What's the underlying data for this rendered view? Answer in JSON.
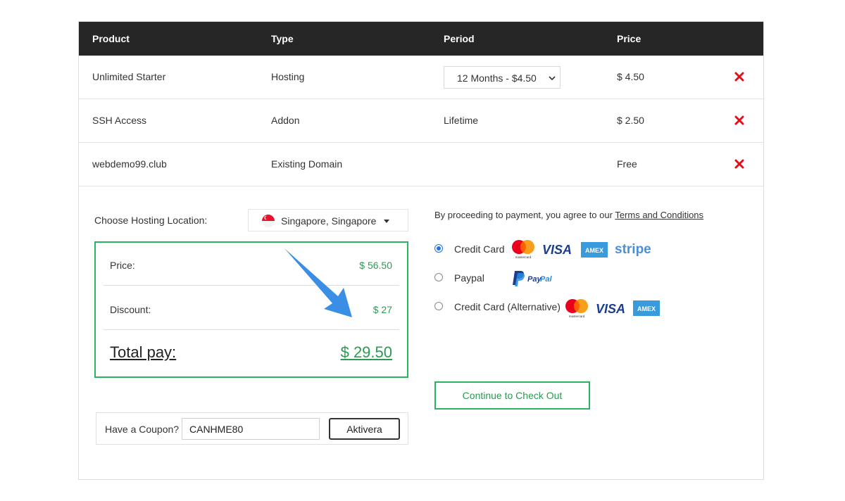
{
  "table": {
    "headers": {
      "product": "Product",
      "type": "Type",
      "period": "Period",
      "price": "Price"
    },
    "rows": [
      {
        "product": "Unlimited Starter",
        "type": "Hosting",
        "period": "12 Months - $4.50",
        "price": "$ 4.50"
      },
      {
        "product": "SSH Access",
        "type": "Addon",
        "period": "Lifetime",
        "price": "$ 2.50"
      },
      {
        "product": "webdemo99.club",
        "type": "Existing Domain",
        "period": "",
        "price": "Free"
      }
    ]
  },
  "location": {
    "label": "Choose Hosting Location:",
    "selected": "Singapore, Singapore",
    "flag_icon": "singapore-flag-icon"
  },
  "summary": {
    "price_label": "Price:",
    "price_value": "$ 56.50",
    "discount_label": "Discount:",
    "discount_value": "$ 27",
    "total_label": "Total pay:",
    "total_value": "$ 29.50"
  },
  "coupon": {
    "label": "Have a Coupon?",
    "value": "CANHME80",
    "button": "Aktivera"
  },
  "payment": {
    "agree_text": "By proceeding to payment, you agree to our ",
    "terms_link": "Terms and Conditions",
    "options": [
      {
        "label": "Credit Card",
        "selected": true
      },
      {
        "label": "Paypal",
        "selected": false
      },
      {
        "label": "Credit Card (Alternative)",
        "selected": false
      }
    ],
    "logos": {
      "visa": "VISA",
      "amex": "AMEX",
      "stripe": "stripe",
      "paypal_pay": "Pay",
      "paypal_pal": "Pal",
      "mastercard": "mastercard"
    }
  },
  "checkout_button": "Continue to Check Out",
  "colors": {
    "header_bg": "#262626",
    "green": "#2cb45c",
    "remove_red": "#e0101b",
    "radio_blue": "#1e73e8"
  }
}
